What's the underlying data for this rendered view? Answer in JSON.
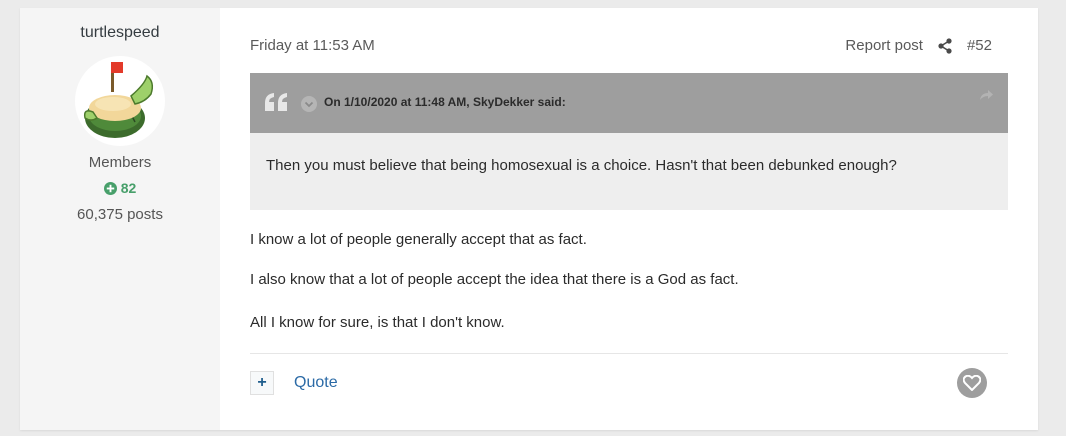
{
  "author": {
    "name": "turtlespeed",
    "group": "Members",
    "reputation": "82",
    "posts": "60,375 posts"
  },
  "post": {
    "date": "Friday at 11:53 AM",
    "report_label": "Report post",
    "number": "#52",
    "quote": {
      "citation": "On 1/10/2020 at 11:48 AM, SkyDekker said:",
      "text": "Then you must believe that being homosexual is a choice. Hasn't that been debunked enough?"
    },
    "paragraphs": [
      "I know a lot of people generally accept that as fact.",
      "I also know that a lot of people accept the idea that there is a God as fact.",
      "All I know for sure, is that I don't know."
    ],
    "footer": {
      "multiquote_label": "+",
      "quote_label": "Quote"
    }
  },
  "colors": {
    "reputation_green": "#479f6a",
    "quote_header_gray": "#9e9e9e",
    "quote_body_gray": "#eeeeee",
    "link_blue": "#2b6aa6"
  },
  "icons": {
    "share": "share-icon",
    "quote_marks": "quote-marks-icon",
    "reputation": "plus-circle-icon",
    "reaction": "heart-icon"
  }
}
